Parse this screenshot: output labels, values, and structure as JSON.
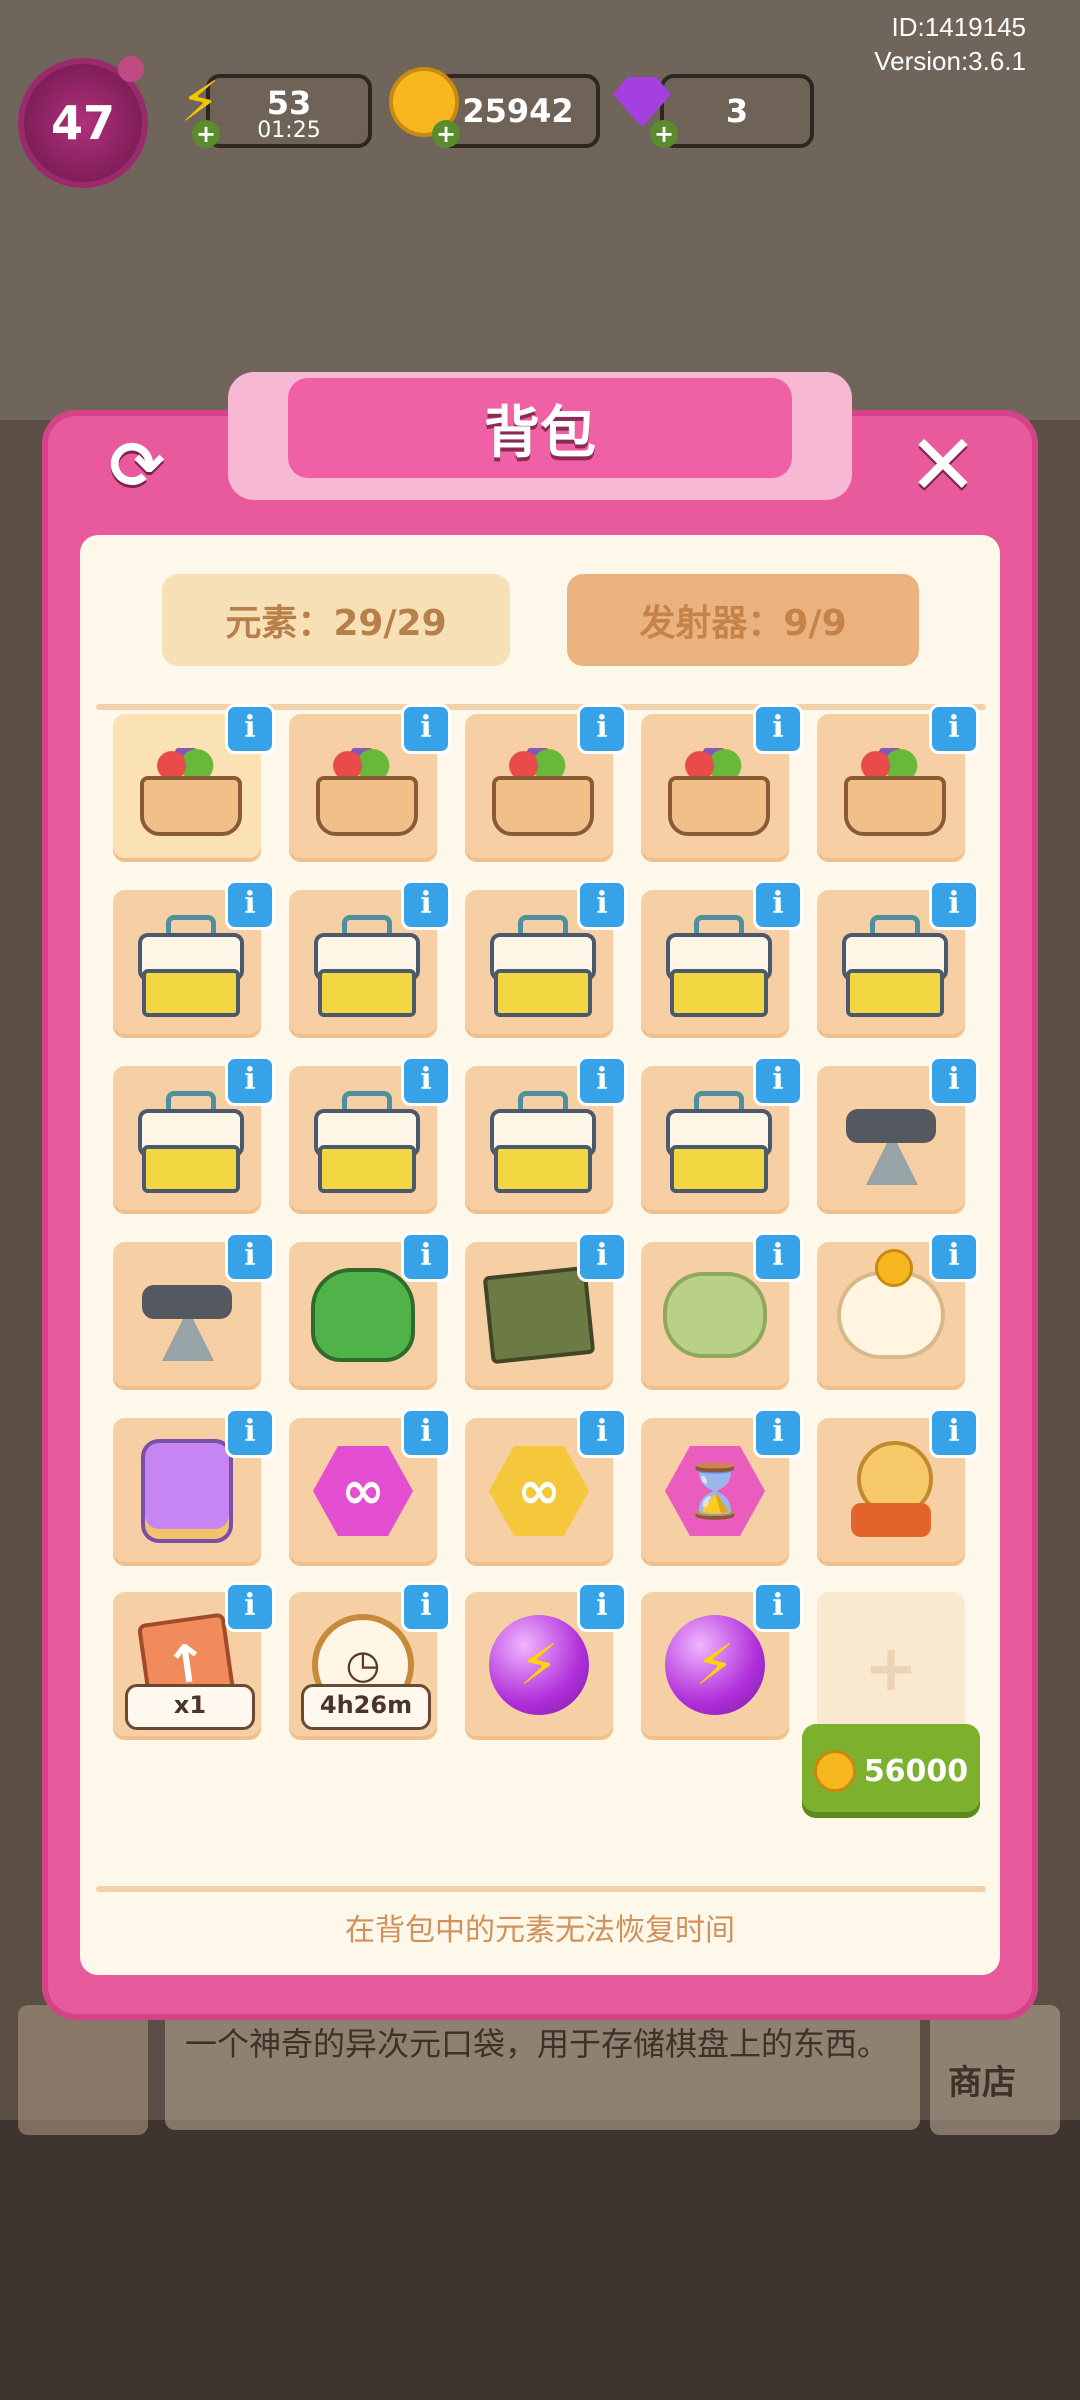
{
  "hud": {
    "id_text": "ID:1419145",
    "version_text": "Version:3.6.1",
    "level": "47",
    "energy": {
      "value": "53",
      "timer": "01:25"
    },
    "coins": {
      "value": "25942"
    },
    "gems": {
      "value": "3"
    }
  },
  "panel": {
    "title": "背包",
    "elements_counter": "元素：29/29",
    "launchers_counter": "发射器：9/9",
    "footer_note": "在背包中的元素无法恢复时间",
    "buy_slot_price": "56000"
  },
  "items": [
    {
      "name": "salad-basket"
    },
    {
      "name": "salad-basket"
    },
    {
      "name": "salad-basket"
    },
    {
      "name": "salad-basket"
    },
    {
      "name": "salad-basket"
    },
    {
      "name": "first-aid-box"
    },
    {
      "name": "first-aid-box"
    },
    {
      "name": "first-aid-box"
    },
    {
      "name": "first-aid-box"
    },
    {
      "name": "first-aid-box"
    },
    {
      "name": "first-aid-box"
    },
    {
      "name": "first-aid-box"
    },
    {
      "name": "first-aid-box"
    },
    {
      "name": "first-aid-box"
    },
    {
      "name": "dumbbell-rack"
    },
    {
      "name": "dumbbell-rack"
    },
    {
      "name": "dino-toy"
    },
    {
      "name": "folded-cloth"
    },
    {
      "name": "frog-cushion"
    },
    {
      "name": "sheep-coin-plush"
    },
    {
      "name": "gem-jar"
    },
    {
      "name": "pink-infinity-hex"
    },
    {
      "name": "gold-infinity-hex"
    },
    {
      "name": "hourglass-hex"
    },
    {
      "name": "plasma-ball"
    },
    {
      "name": "upgrade-card",
      "badge": "x1"
    },
    {
      "name": "stopwatch",
      "badge": "4h26m"
    },
    {
      "name": "energy-orb"
    },
    {
      "name": "energy-orb"
    }
  ],
  "background": {
    "description": "一个神奇的异次元口袋，用于存储棋盘上的东西。",
    "shop_label": "商店"
  },
  "colors": {
    "panel": "#e85a9c",
    "accent_info": "#36a3e8",
    "buy_button": "#7db12d"
  }
}
